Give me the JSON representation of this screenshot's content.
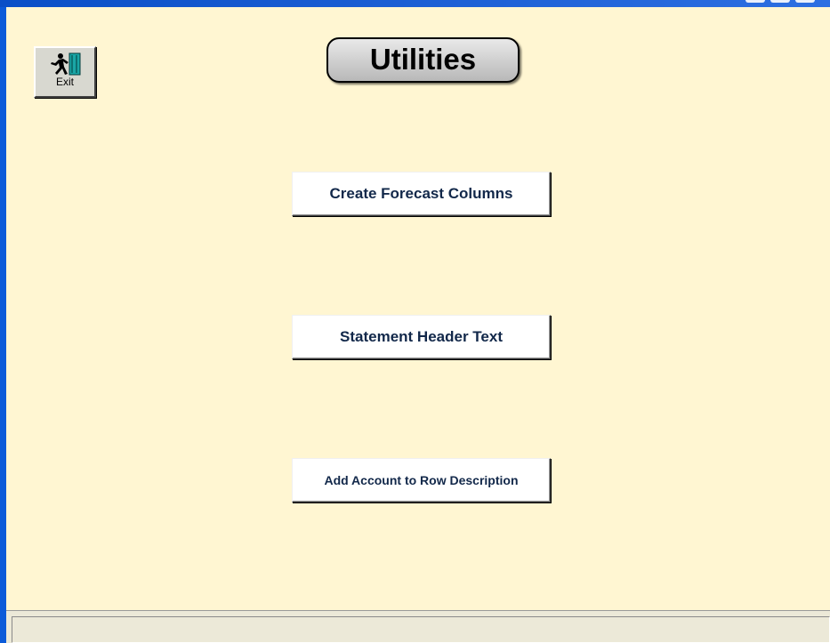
{
  "screen": {
    "title": "Utilities"
  },
  "toolbar": {
    "exit_label": "Exit",
    "exit_icon": "running-man-door-icon"
  },
  "actions": [
    {
      "label": "Create Forecast Columns"
    },
    {
      "label": "Statement Header Text"
    },
    {
      "label": "Add Account to Row Description"
    }
  ],
  "colors": {
    "background": "#fff6d2",
    "window_border": "#0c5bd9",
    "button_text": "#12284a"
  }
}
